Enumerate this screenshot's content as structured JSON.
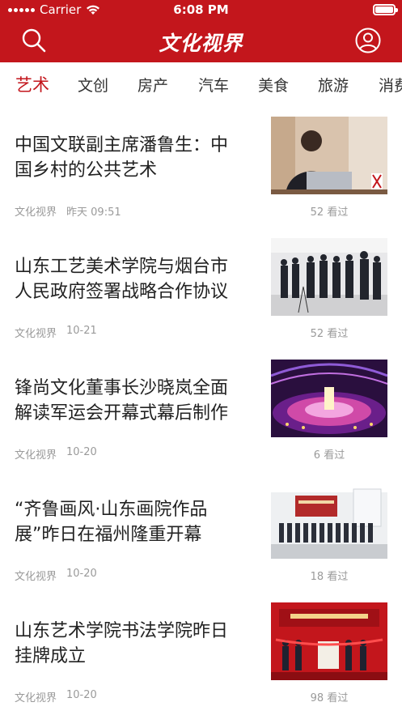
{
  "status_bar": {
    "carrier": "Carrier",
    "time": "6:08 PM"
  },
  "header": {
    "logo_text": "文化视界",
    "search_icon": "search-icon",
    "user_icon": "user-icon",
    "bg_color": "#c3161c"
  },
  "tabs": [
    {
      "label": "艺术",
      "active": true
    },
    {
      "label": "文创",
      "active": false
    },
    {
      "label": "房产",
      "active": false
    },
    {
      "label": "汽车",
      "active": false
    },
    {
      "label": "美食",
      "active": false
    },
    {
      "label": "旅游",
      "active": false
    },
    {
      "label": "消费",
      "active": false
    }
  ],
  "articles": [
    {
      "title": "中国文联副主席潘鲁生：中国乡村的公共艺术",
      "source": "文化视界",
      "time": "昨天 09:51",
      "views": "52 看过"
    },
    {
      "title": "山东工艺美术学院与烟台市人民政府签署战略合作协议",
      "source": "文化视界",
      "time": "10-21",
      "views": "52 看过"
    },
    {
      "title": "锋尚文化董事长沙晓岚全面解读军运会开幕式幕后制作",
      "source": "文化视界",
      "time": "10-20",
      "views": "6 看过"
    },
    {
      "title": "“齐鲁画风·山东画院作品展”昨日在福州隆重开幕",
      "source": "文化视界",
      "time": "10-20",
      "views": "18 看过"
    },
    {
      "title": "山东艺术学院书法学院昨日挂牌成立",
      "source": "文化视界",
      "time": "10-20",
      "views": "98 看过"
    }
  ],
  "accent_color": "#c3161c"
}
